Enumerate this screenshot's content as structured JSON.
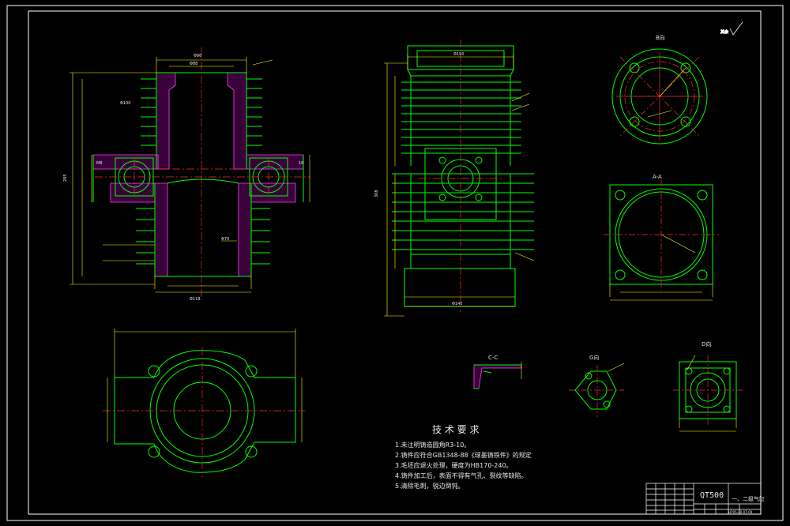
{
  "colors": {
    "background": "#000000",
    "frame": "#ffffff",
    "outline": "#00ff00",
    "centerline": "#ff2a2a",
    "dimension": "#ffff00",
    "hatch": "#ff40ff",
    "text": "#e8e8e8"
  },
  "views": {
    "b_view_title": "B向",
    "section_aa_title": "A-A",
    "section_cc_title": "C-C",
    "g_view_title": "G向",
    "d_view_title": "D向"
  },
  "tech_requirements": {
    "title": "技 术 要 求",
    "items": [
      "1.未注明铸造圆角R3-10。",
      "2.铸件应符合GB1348-88《球墨铸铁件》的规定",
      "3.毛坯应退火处理，硬度为HB170-240。",
      "4.铸件加工后，表面不得有气孔、裂纹等缺陷。",
      "5.清除毛刺，锐边倒钝。"
    ]
  },
  "title_block": {
    "material": "QT500",
    "part_name": "一、二级气缸",
    "drawing_number": "H795-20-07-09"
  }
}
